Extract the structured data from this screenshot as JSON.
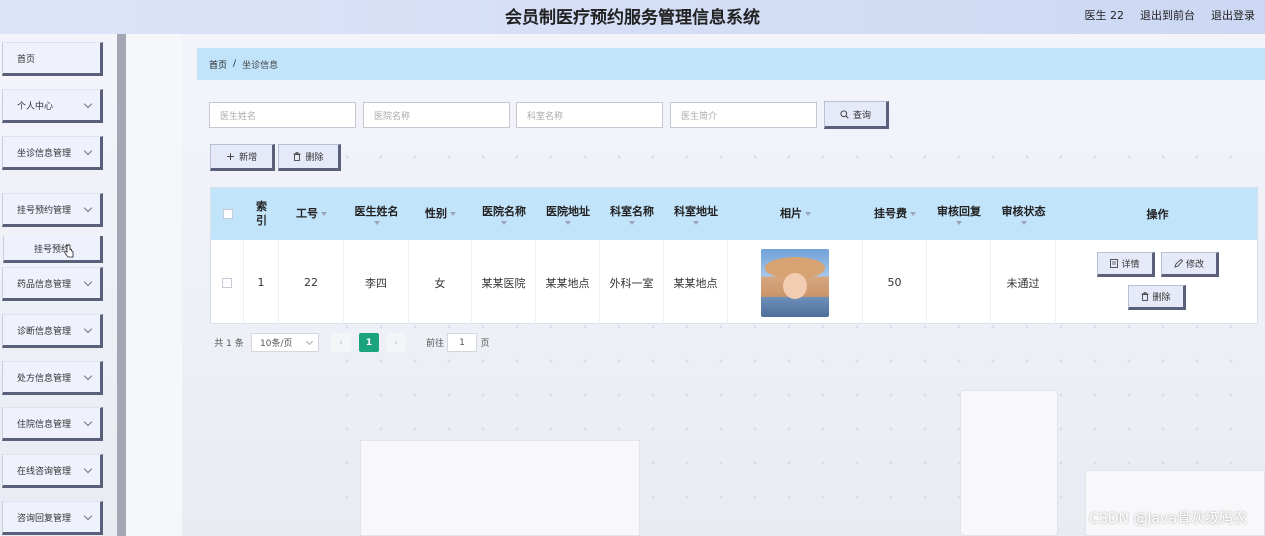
{
  "header": {
    "title": "会员制医疗预约服务管理信息系统",
    "user": "医生 22",
    "to_front": "退出到前台",
    "logout": "退出登录"
  },
  "sidebar": {
    "items": [
      {
        "label": "首页",
        "has_chevron": false
      },
      {
        "label": "个人中心",
        "has_chevron": true
      },
      {
        "label": "坐诊信息管理",
        "has_chevron": true
      },
      {
        "label": "挂号预约管理",
        "has_chevron": true
      },
      {
        "label": "药品信息管理",
        "has_chevron": true
      },
      {
        "label": "诊断信息管理",
        "has_chevron": true
      },
      {
        "label": "处方信息管理",
        "has_chevron": true
      },
      {
        "label": "住院信息管理",
        "has_chevron": true
      },
      {
        "label": "在线咨询管理",
        "has_chevron": true
      },
      {
        "label": "咨询回复管理",
        "has_chevron": true
      }
    ],
    "sub_item": "挂号预约"
  },
  "breadcrumb": {
    "home": "首页",
    "separator": "/",
    "current": "坐诊信息"
  },
  "search": {
    "doctor_name_placeholder": "医生姓名",
    "hospital_name_placeholder": "医院名称",
    "department_name_placeholder": "科室名称",
    "doctor_intro_placeholder": "医生简介",
    "query_button": "查询"
  },
  "actions": {
    "add": "新增",
    "delete": "删除"
  },
  "table": {
    "headers": {
      "index": "索引",
      "job_no": "工号",
      "doctor_name": "医生姓名",
      "gender": "性别",
      "hospital_name": "医院名称",
      "hospital_address": "医院地址",
      "department_name": "科室名称",
      "department_address": "科室地址",
      "photo": "相片",
      "fee": "挂号费",
      "review_reply": "审核回复",
      "review_status": "审核状态",
      "operations": "操作"
    },
    "rows": [
      {
        "index": "1",
        "job_no": "22",
        "doctor_name": "李四",
        "gender": "女",
        "hospital_name": "某某医院",
        "hospital_address": "某某地点",
        "department_name": "外科一室",
        "department_address": "某某地点",
        "fee": "50",
        "review_reply": "",
        "review_status": "未通过"
      }
    ],
    "row_buttons": {
      "detail": "详情",
      "edit": "修改",
      "delete": "删除"
    }
  },
  "pagination": {
    "total": "共 1 条",
    "page_size": "10条/页",
    "current_page": "1",
    "goto_label": "前往",
    "goto_value": "1",
    "page_suffix": "页"
  },
  "watermark": "CSDN @Java骨灰级码农",
  "colors": {
    "header_bg": "#ccd8f3",
    "table_header_bg": "#c2e4fb",
    "active_page": "#1aa37c",
    "button_border": "#5a6079"
  }
}
